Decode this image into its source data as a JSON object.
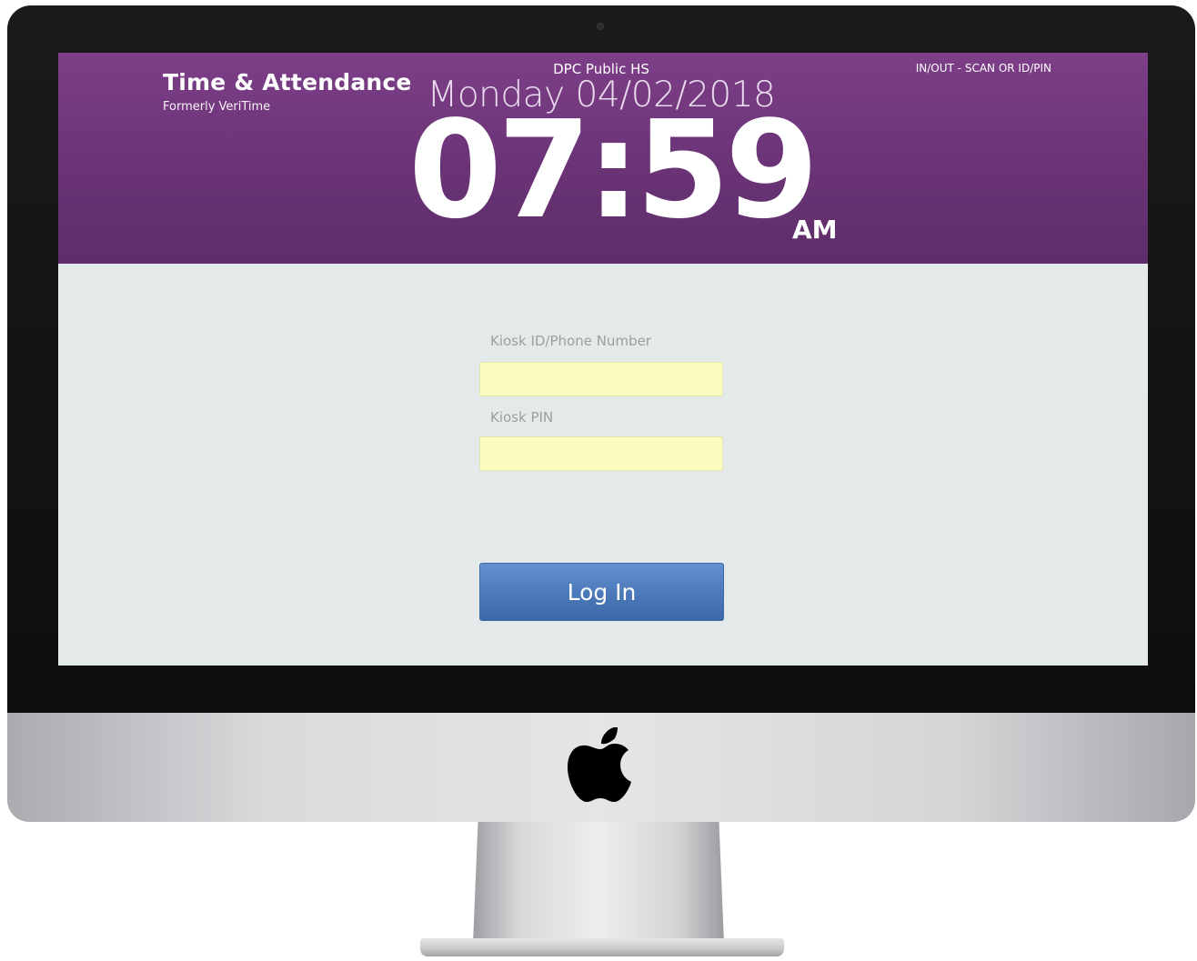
{
  "header": {
    "app_title": "Time & Attendance",
    "app_subtitle": "Formerly VeriTime",
    "location": "DPC Public HS",
    "date": "Monday 04/02/2018",
    "time": "07:59",
    "meridiem": "AM",
    "mode": "IN/OUT - SCAN OR ID/PIN"
  },
  "login_form": {
    "kiosk_id_label": "Kiosk ID/Phone Number",
    "kiosk_id_value": "",
    "kiosk_pin_label": "Kiosk PIN",
    "kiosk_pin_value": "",
    "submit_label": "Log In"
  },
  "colors": {
    "header_purple": "#6a3376",
    "screen_background": "#e4eaea",
    "input_fill": "#fbfcbd",
    "button_blue": "#4b78b8"
  },
  "icons": {
    "monitor_logo": "apple-logo"
  }
}
